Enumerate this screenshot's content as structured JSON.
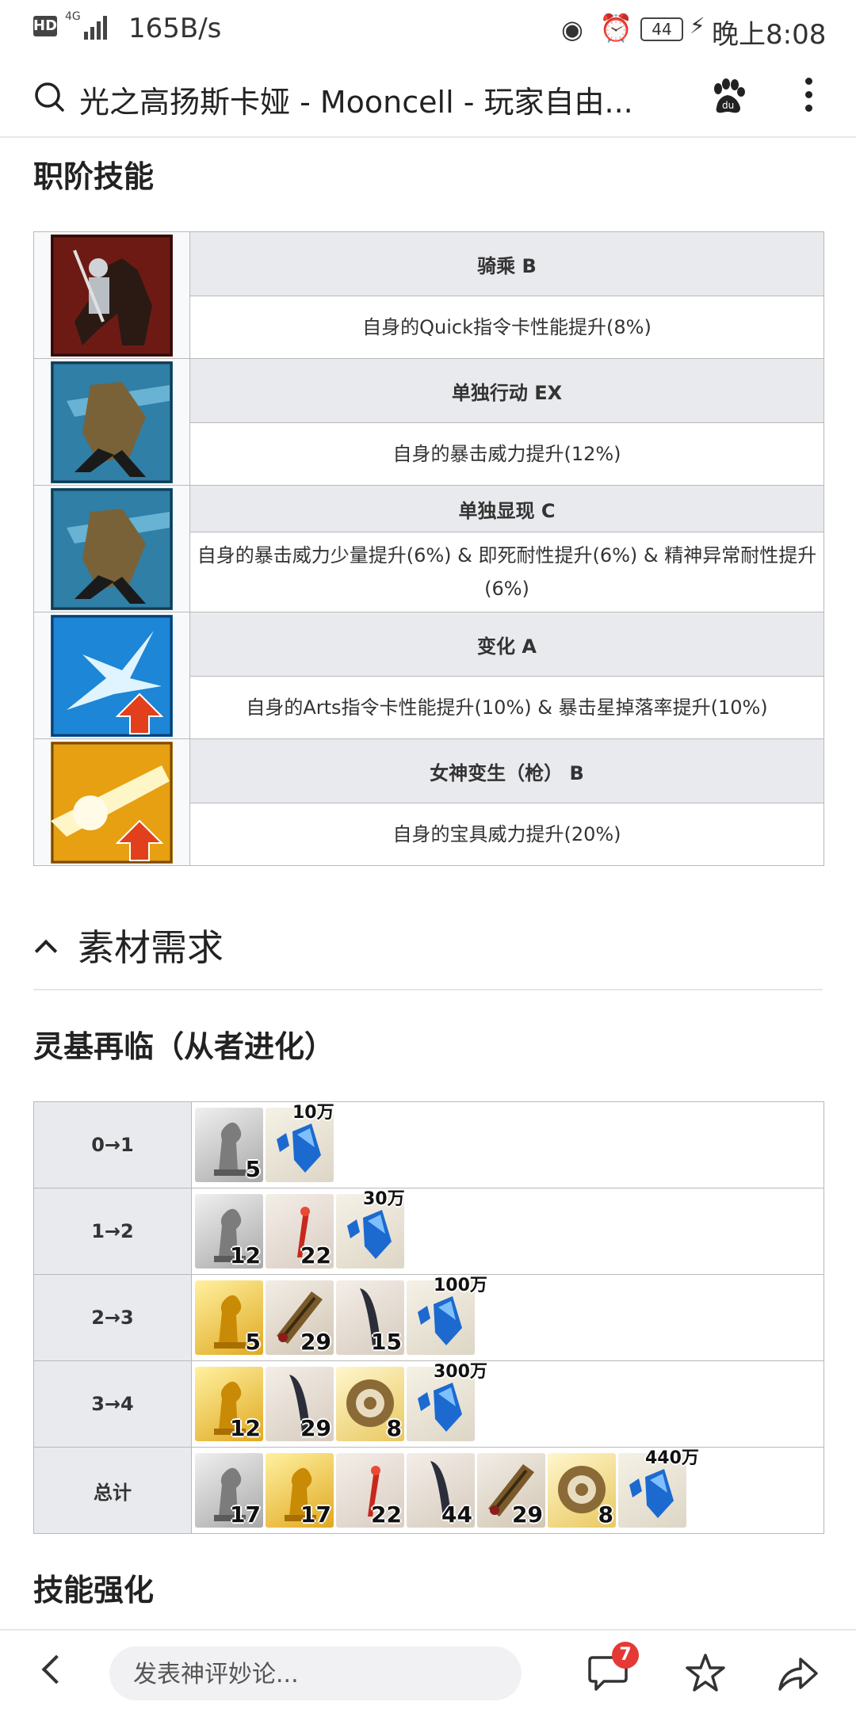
{
  "status_bar": {
    "hd": "HD",
    "network": "4G",
    "speed": "165B/s",
    "battery": "44",
    "time": "晚上8:08"
  },
  "address_bar": {
    "title": "光之高扬斯卡娅 - Mooncell - 玩家自由..."
  },
  "class_skills": {
    "heading": "职阶技能",
    "items": [
      {
        "name": "骑乘 B",
        "desc": "自身的Quick指令卡性能提升(8%)",
        "icon": "knight-rider-icon"
      },
      {
        "name": "单独行动 EX",
        "desc": "自身的暴击威力提升(12%)",
        "icon": "cloaked-figure-icon"
      },
      {
        "name": "单独显现 C",
        "desc": "自身的暴击威力少量提升(6%) & 即死耐性提升(6%) & 精神异常耐性提升(6%)",
        "icon": "cloaked-figure-icon"
      },
      {
        "name": "变化 A",
        "desc": "自身的Arts指令卡性能提升(10%) & 暴击星掉落率提升(10%)",
        "icon": "star-burst-up-icon"
      },
      {
        "name": "女神变生（枪） B",
        "desc": "自身的宝具威力提升(20%)",
        "icon": "golden-flash-up-icon"
      }
    ]
  },
  "materials": {
    "section_title": "素材需求",
    "ascension_heading": "灵基再临（从者进化）",
    "rows": [
      {
        "label": "0→1",
        "items": [
          {
            "type": "silver",
            "count": "5"
          }
        ],
        "qp": "10万"
      },
      {
        "label": "1→2",
        "items": [
          {
            "type": "silver",
            "count": "12"
          },
          {
            "type": "feather",
            "count": "22"
          }
        ],
        "qp": "30万"
      },
      {
        "label": "2→3",
        "items": [
          {
            "type": "gold",
            "count": "5"
          },
          {
            "type": "horn",
            "count": "29"
          },
          {
            "type": "claw",
            "count": "15"
          }
        ],
        "qp": "100万"
      },
      {
        "label": "3→4",
        "items": [
          {
            "type": "gold",
            "count": "12"
          },
          {
            "type": "claw",
            "count": "29"
          },
          {
            "type": "gear",
            "count": "8"
          }
        ],
        "qp": "300万"
      },
      {
        "label": "总计",
        "items": [
          {
            "type": "silver",
            "count": "17"
          },
          {
            "type": "gold",
            "count": "17"
          },
          {
            "type": "feather",
            "count": "22"
          },
          {
            "type": "claw",
            "count": "44"
          },
          {
            "type": "horn",
            "count": "29"
          },
          {
            "type": "gear",
            "count": "8"
          }
        ],
        "qp": "440万"
      }
    ]
  },
  "skill_enhance": {
    "heading": "技能强化"
  },
  "bottom_bar": {
    "comment_placeholder": "发表神评妙论...",
    "comment_count": "7"
  }
}
